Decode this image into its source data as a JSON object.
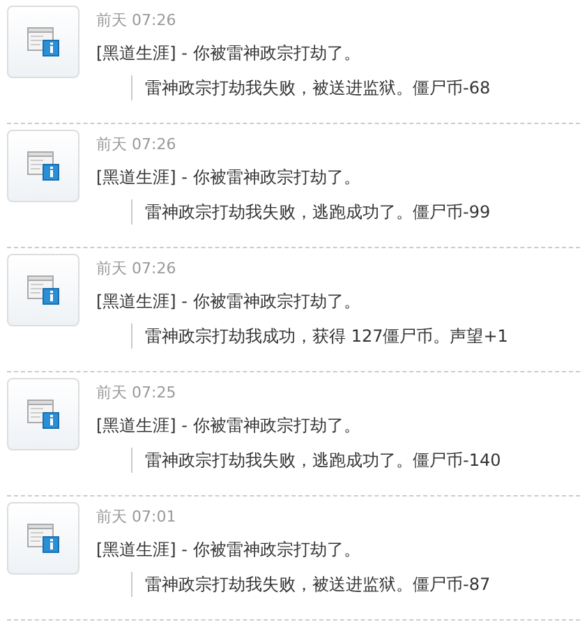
{
  "feed": [
    {
      "time": "前天 07:26",
      "title": "[黑道生涯] - 你被雷神政宗打劫了。",
      "detail": "雷神政宗打劫我失败，被送进监狱。僵尸币-68"
    },
    {
      "time": "前天 07:26",
      "title": "[黑道生涯] - 你被雷神政宗打劫了。",
      "detail": "雷神政宗打劫我失败，逃跑成功了。僵尸币-99"
    },
    {
      "time": "前天 07:26",
      "title": "[黑道生涯] - 你被雷神政宗打劫了。",
      "detail": "雷神政宗打劫我成功，获得 127僵尸币。声望+1"
    },
    {
      "time": "前天 07:25",
      "title": "[黑道生涯] - 你被雷神政宗打劫了。",
      "detail": "雷神政宗打劫我失败，逃跑成功了。僵尸币-140"
    },
    {
      "time": "前天 07:01",
      "title": "[黑道生涯] - 你被雷神政宗打劫了。",
      "detail": "雷神政宗打劫我失败，被送进监狱。僵尸币-87"
    }
  ]
}
